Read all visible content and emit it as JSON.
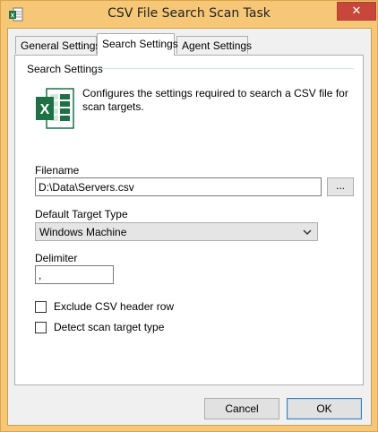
{
  "window": {
    "title": "CSV File Search Scan Task",
    "close_glyph": "✕"
  },
  "tabs": [
    {
      "label": "General Settings",
      "active": false
    },
    {
      "label": "Search Settings",
      "active": true
    },
    {
      "label": "Agent Settings",
      "active": false
    }
  ],
  "search_settings": {
    "group_label": "Search Settings",
    "description": "Configures the settings required to search a CSV file for scan targets.",
    "filename_label": "Filename",
    "filename_value": "D:\\Data\\Servers.csv",
    "browse_label": "...",
    "target_type_label": "Default Target Type",
    "target_type_value": "Windows Machine",
    "delimiter_label": "Delimiter",
    "delimiter_value": ",",
    "exclude_header_label": "Exclude CSV header row",
    "exclude_header_checked": false,
    "detect_type_label": "Detect scan target type",
    "detect_type_checked": false
  },
  "buttons": {
    "cancel": "Cancel",
    "ok": "OK"
  },
  "icons": {
    "app": "csv-app-icon",
    "excel": "excel-icon",
    "close": "close-icon",
    "dropdown": "chevron-down-icon"
  },
  "colors": {
    "title_bar": "#f6c777",
    "close_button": "#c7483b",
    "excel_green": "#1e7145"
  }
}
